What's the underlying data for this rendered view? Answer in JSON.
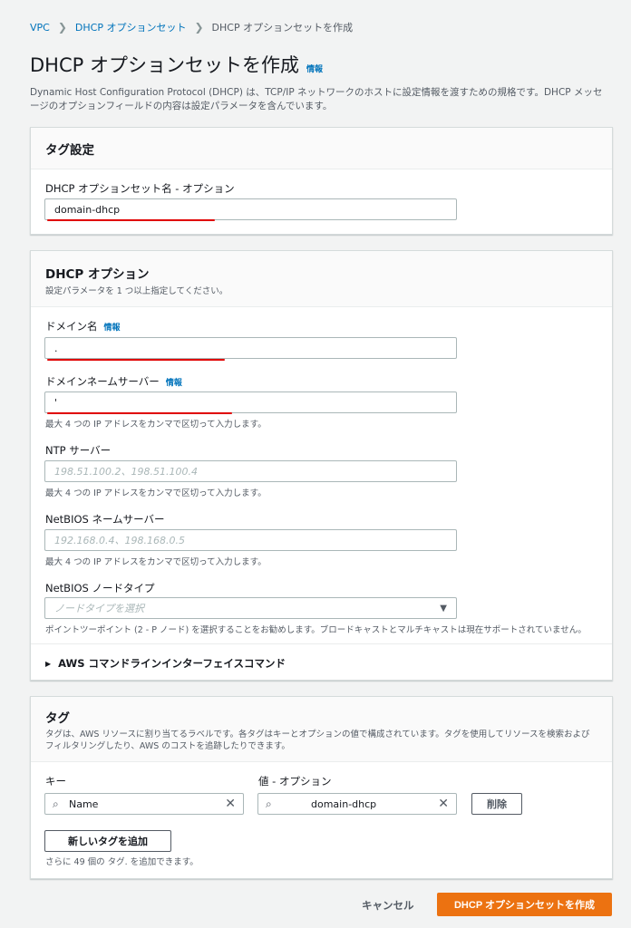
{
  "breadcrumb": {
    "items": [
      "VPC",
      "DHCP オプションセット",
      "DHCP オプションセットを作成"
    ]
  },
  "page": {
    "title": "DHCP オプションセットを作成",
    "info": "情報",
    "description": "Dynamic Host Configuration Protocol (DHCP) は、TCP/IP ネットワークのホストに設定情報を渡すための規格です。DHCP メッセージのオプションフィールドの内容は設定パラメータを含んでいます。"
  },
  "tag_settings": {
    "header": "タグ設定",
    "name_label": "DHCP オプションセット名 - オプション",
    "name_value": "domain-dhcp"
  },
  "dhcp_options": {
    "header": "DHCP オプション",
    "subheader": "設定パラメータを 1 つ以上指定してください。",
    "domain_name_label": "ドメイン名",
    "domain_name_info": "情報",
    "domain_name_value": ".",
    "dns_label": "ドメインネームサーバー",
    "dns_info": "情報",
    "dns_value": "'",
    "dns_hint": "最大 4 つの IP アドレスをカンマで区切って入力します。",
    "ntp_label": "NTP サーバー",
    "ntp_placeholder": "198.51.100.2、198.51.100.4",
    "ntp_hint": "最大 4 つの IP アドレスをカンマで区切って入力します。",
    "netbios_ns_label": "NetBIOS ネームサーバー",
    "netbios_ns_placeholder": "192.168.0.4、198.168.0.5",
    "netbios_ns_hint": "最大 4 つの IP アドレスをカンマで区切って入力します。",
    "netbios_type_label": "NetBIOS ノードタイプ",
    "netbios_type_placeholder": "ノードタイプを選択",
    "netbios_type_hint": "ポイントツーポイント (2 - P ノード) を選択することをお勧めします。ブロードキャストとマルチキャストは現在サポートされていません。",
    "cli_expander": "AWS コマンドラインインターフェイスコマンド"
  },
  "tags": {
    "header": "タグ",
    "description": "タグは、AWS リソースに割り当てるラベルです。各タグはキーとオプションの値で構成されています。タグを使用してリソースを検索およびフィルタリングしたり、AWS のコストを追跡したりできます。",
    "key_label": "キー",
    "value_label": "値 - オプション",
    "key_value": "Name",
    "value_value": "domain-dhcp",
    "remove_button": "削除",
    "add_button": "新しいタグを追加",
    "remaining_hint": "さらに 49 個の タグ. を追加できます。"
  },
  "footer": {
    "cancel": "キャンセル",
    "submit": "DHCP オプションセットを作成"
  },
  "colors": {
    "link": "#0073bb",
    "primary": "#ec7211",
    "annotation": "#e00000"
  }
}
